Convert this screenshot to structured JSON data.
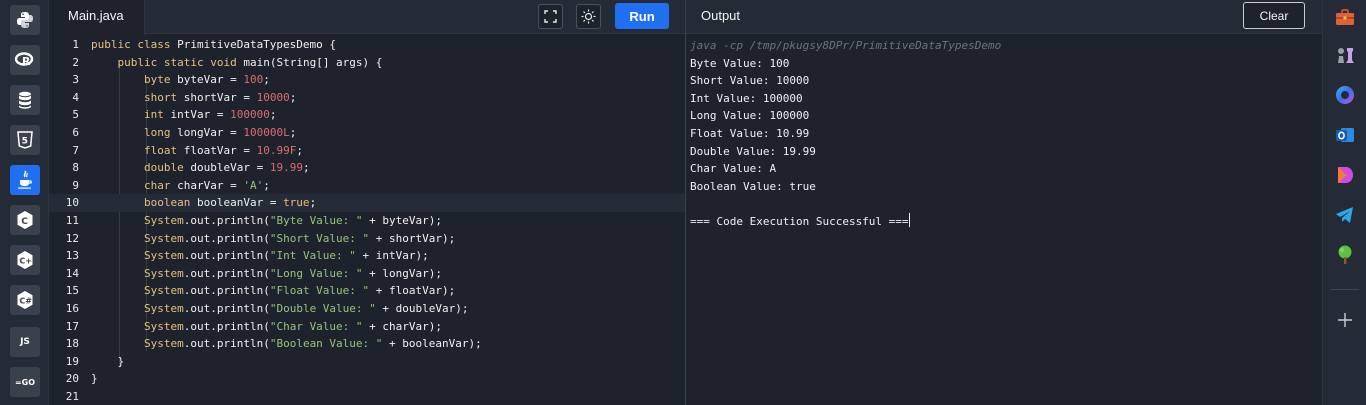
{
  "sidebar": {
    "languages": [
      {
        "name": "python",
        "label": ""
      },
      {
        "name": "r",
        "label": "R"
      },
      {
        "name": "sql",
        "label": ""
      },
      {
        "name": "html",
        "label": "5"
      },
      {
        "name": "java",
        "label": "",
        "active": true
      },
      {
        "name": "c",
        "label": "C"
      },
      {
        "name": "cpp",
        "label": "C+"
      },
      {
        "name": "csharp",
        "label": "C#"
      },
      {
        "name": "javascript",
        "label": "JS"
      },
      {
        "name": "go",
        "label": "=GO"
      }
    ]
  },
  "editor": {
    "tab_label": "Main.java",
    "run_label": "Run",
    "lines": [
      "1",
      "2",
      "3",
      "4",
      "5",
      "6",
      "7",
      "8",
      "9",
      "10",
      "11",
      "12",
      "13",
      "14",
      "15",
      "16",
      "17",
      "18",
      "19",
      "20",
      "21"
    ]
  },
  "code": [
    [
      {
        "t": "kw",
        "v": "public class "
      },
      {
        "t": "id",
        "v": "PrimitiveDataTypesDemo {"
      }
    ],
    [
      {
        "t": "id",
        "v": "    "
      },
      {
        "t": "kw",
        "v": "public static void "
      },
      {
        "t": "id",
        "v": "main(String[] args) {"
      }
    ],
    [
      {
        "t": "id",
        "v": "        "
      },
      {
        "t": "kw",
        "v": "byte "
      },
      {
        "t": "id",
        "v": "byteVar = "
      },
      {
        "t": "num",
        "v": "100"
      },
      {
        "t": "id",
        "v": ";"
      }
    ],
    [
      {
        "t": "id",
        "v": "        "
      },
      {
        "t": "kw",
        "v": "short "
      },
      {
        "t": "id",
        "v": "shortVar = "
      },
      {
        "t": "num",
        "v": "10000"
      },
      {
        "t": "id",
        "v": ";"
      }
    ],
    [
      {
        "t": "id",
        "v": "        "
      },
      {
        "t": "kw",
        "v": "int "
      },
      {
        "t": "id",
        "v": "intVar = "
      },
      {
        "t": "num",
        "v": "100000"
      },
      {
        "t": "id",
        "v": ";"
      }
    ],
    [
      {
        "t": "id",
        "v": "        "
      },
      {
        "t": "kw",
        "v": "long "
      },
      {
        "t": "id",
        "v": "longVar = "
      },
      {
        "t": "num",
        "v": "100000L"
      },
      {
        "t": "id",
        "v": ";"
      }
    ],
    [
      {
        "t": "id",
        "v": "        "
      },
      {
        "t": "kw",
        "v": "float "
      },
      {
        "t": "id",
        "v": "floatVar = "
      },
      {
        "t": "num",
        "v": "10.99F"
      },
      {
        "t": "id",
        "v": ";"
      }
    ],
    [
      {
        "t": "id",
        "v": "        "
      },
      {
        "t": "kw",
        "v": "double "
      },
      {
        "t": "id",
        "v": "doubleVar = "
      },
      {
        "t": "num",
        "v": "19.99"
      },
      {
        "t": "id",
        "v": ";"
      }
    ],
    [
      {
        "t": "id",
        "v": "        "
      },
      {
        "t": "kw",
        "v": "char "
      },
      {
        "t": "id",
        "v": "charVar = "
      },
      {
        "t": "str",
        "v": "'A'"
      },
      {
        "t": "id",
        "v": ";"
      }
    ],
    [
      {
        "t": "id",
        "v": "        "
      },
      {
        "t": "kw",
        "v": "boolean "
      },
      {
        "t": "id",
        "v": "booleanVar = "
      },
      {
        "t": "kw",
        "v": "true"
      },
      {
        "t": "id",
        "v": ";"
      }
    ],
    [
      {
        "t": "id",
        "v": "        "
      },
      {
        "t": "kw",
        "v": "System"
      },
      {
        "t": "id",
        "v": ".out.println("
      },
      {
        "t": "str",
        "v": "\"Byte Value: \""
      },
      {
        "t": "id",
        "v": " + byteVar);"
      }
    ],
    [
      {
        "t": "id",
        "v": "        "
      },
      {
        "t": "kw",
        "v": "System"
      },
      {
        "t": "id",
        "v": ".out.println("
      },
      {
        "t": "str",
        "v": "\"Short Value: \""
      },
      {
        "t": "id",
        "v": " + shortVar);"
      }
    ],
    [
      {
        "t": "id",
        "v": "        "
      },
      {
        "t": "kw",
        "v": "System"
      },
      {
        "t": "id",
        "v": ".out.println("
      },
      {
        "t": "str",
        "v": "\"Int Value: \""
      },
      {
        "t": "id",
        "v": " + intVar);"
      }
    ],
    [
      {
        "t": "id",
        "v": "        "
      },
      {
        "t": "kw",
        "v": "System"
      },
      {
        "t": "id",
        "v": ".out.println("
      },
      {
        "t": "str",
        "v": "\"Long Value: \""
      },
      {
        "t": "id",
        "v": " + longVar);"
      }
    ],
    [
      {
        "t": "id",
        "v": "        "
      },
      {
        "t": "kw",
        "v": "System"
      },
      {
        "t": "id",
        "v": ".out.println("
      },
      {
        "t": "str",
        "v": "\"Float Value: \""
      },
      {
        "t": "id",
        "v": " + floatVar);"
      }
    ],
    [
      {
        "t": "id",
        "v": "        "
      },
      {
        "t": "kw",
        "v": "System"
      },
      {
        "t": "id",
        "v": ".out.println("
      },
      {
        "t": "str",
        "v": "\"Double Value: \""
      },
      {
        "t": "id",
        "v": " + doubleVar);"
      }
    ],
    [
      {
        "t": "id",
        "v": "        "
      },
      {
        "t": "kw",
        "v": "System"
      },
      {
        "t": "id",
        "v": ".out.println("
      },
      {
        "t": "str",
        "v": "\"Char Value: \""
      },
      {
        "t": "id",
        "v": " + charVar);"
      }
    ],
    [
      {
        "t": "id",
        "v": "        "
      },
      {
        "t": "kw",
        "v": "System"
      },
      {
        "t": "id",
        "v": ".out.println("
      },
      {
        "t": "str",
        "v": "\"Boolean Value: \""
      },
      {
        "t": "id",
        "v": " + booleanVar);"
      }
    ],
    [
      {
        "t": "id",
        "v": "    }"
      }
    ],
    [
      {
        "t": "id",
        "v": "}"
      }
    ],
    [
      {
        "t": "id",
        "v": ""
      }
    ]
  ],
  "output": {
    "title": "Output",
    "clear_label": "Clear",
    "command": "java -cp /tmp/pkugsy8DPr/PrimitiveDataTypesDemo",
    "lines": [
      "Byte Value: 100",
      "Short Value: 10000",
      "Int Value: 100000",
      "Long Value: 100000",
      "Float Value: 10.99",
      "Double Value: 19.99",
      "Char Value: A",
      "Boolean Value: true",
      "",
      "=== Code Execution Successful ==="
    ]
  },
  "app_bar": {
    "icons": [
      "toolbox-icon",
      "chess-icon",
      "copilot-icon",
      "outlook-icon",
      "designer-icon",
      "telegram-icon",
      "tree-icon",
      "add-icon"
    ]
  },
  "colors": {
    "accent": "#1f6ff2",
    "keyword": "#e8c07d",
    "number": "#e06c6c",
    "string": "#98c379"
  }
}
